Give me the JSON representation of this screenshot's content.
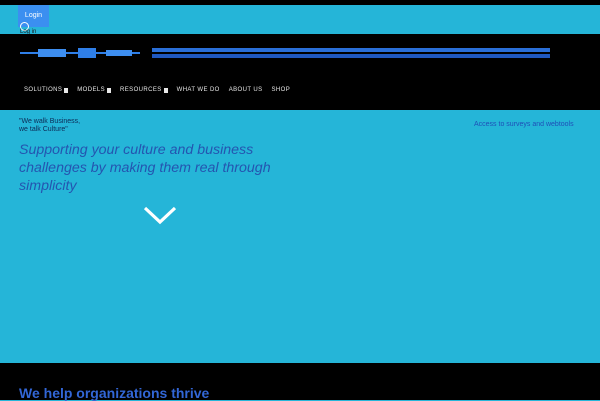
{
  "login": {
    "button_label": "Login",
    "sub_label": "Log in",
    "user_icon": "user-circle-icon"
  },
  "header": {
    "logo_icon": "brand-logo"
  },
  "nav": {
    "items": [
      {
        "label": "SOLUTIONS",
        "has_caret": true
      },
      {
        "label": "MODELS",
        "has_caret": true
      },
      {
        "label": "RESOURCES",
        "has_caret": true
      },
      {
        "label": "WHAT WE DO",
        "has_caret": false
      },
      {
        "label": "ABOUT US",
        "has_caret": false
      },
      {
        "label": "SHOP",
        "has_caret": false
      }
    ]
  },
  "hero": {
    "tagline_line1": "\"We walk Business,",
    "tagline_line2": "we talk Culture\"",
    "access_link": "Access to surveys and webtools",
    "heading": "Supporting your culture and business challenges by making them real through simplicity",
    "chevron_icon": "chevron-down-icon"
  },
  "section": {
    "heading": "We help organizations thrive"
  },
  "colors": {
    "background": "#25b5d8",
    "header": "#000000",
    "accent": "#3b8ff0",
    "heading_text": "#2455b0"
  }
}
